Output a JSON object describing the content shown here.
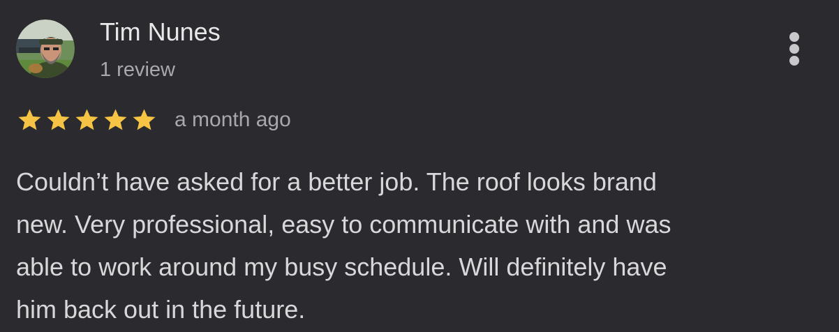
{
  "reviewer": {
    "name": "Tim Nunes",
    "review_count": "1 review",
    "avatar_icon": "reviewer-photo-avatar"
  },
  "rating": {
    "stars": 5,
    "max_stars": 5,
    "star_color": "#f6c344",
    "date": "a month ago"
  },
  "review": {
    "lines": [
      "Couldn’t have asked for a better job. The roof looks brand",
      "new. Very professional, easy to communicate with and was",
      "able to work around my busy schedule. Will definitely have",
      "him back out in the future."
    ]
  },
  "menu": {
    "icon": "more-vert-icon"
  },
  "colors": {
    "background": "#2b2b2f",
    "primary_text": "#e8e8e8",
    "secondary_text": "#a9a9ad"
  }
}
